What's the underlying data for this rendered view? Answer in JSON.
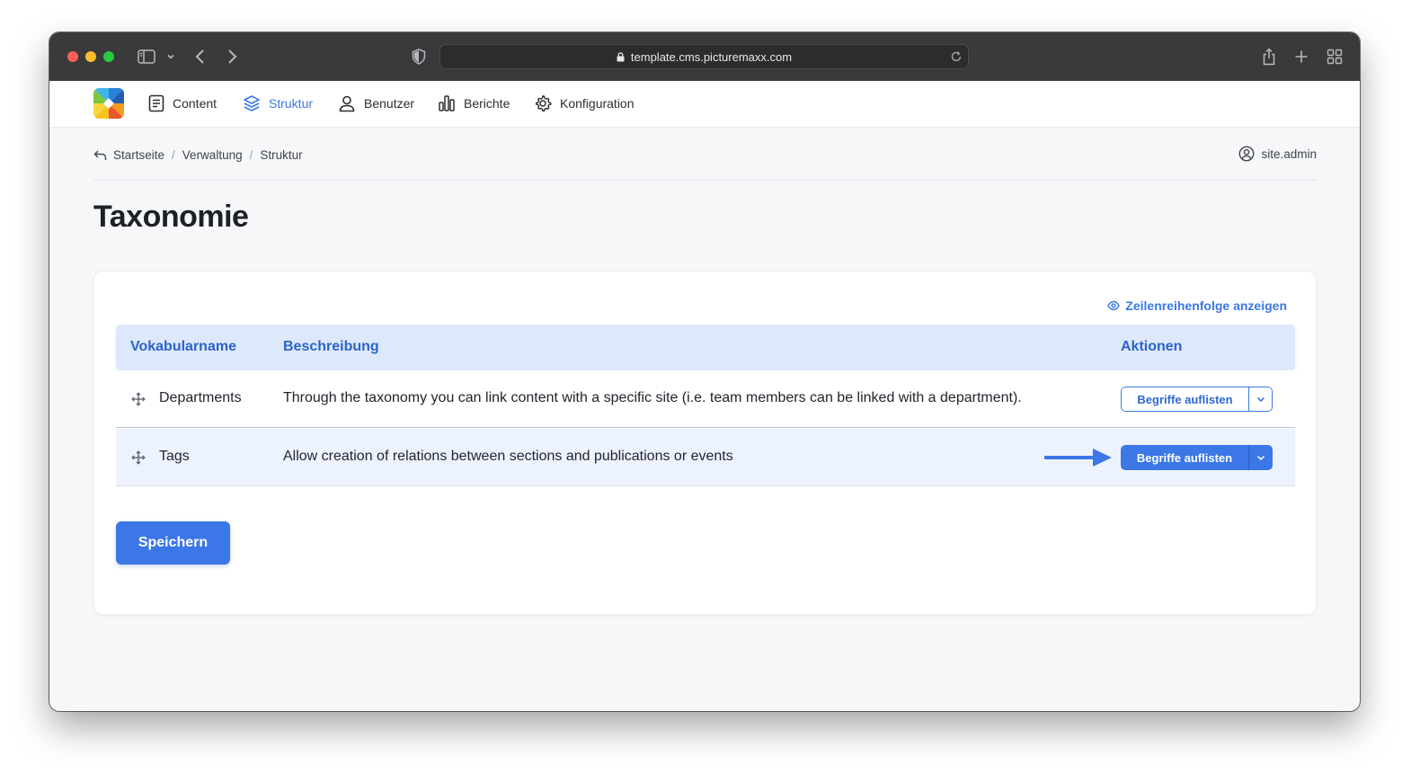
{
  "browser": {
    "url": "template.cms.picturemaxx.com"
  },
  "nav": {
    "items": [
      {
        "label": "Content",
        "icon": "document-icon"
      },
      {
        "label": "Struktur",
        "icon": "layers-icon",
        "active": true
      },
      {
        "label": "Benutzer",
        "icon": "user-icon"
      },
      {
        "label": "Berichte",
        "icon": "bar-chart-icon"
      },
      {
        "label": "Konfiguration",
        "icon": "gear-icon"
      }
    ]
  },
  "breadcrumb": [
    "Startseite",
    "Verwaltung",
    "Struktur"
  ],
  "user": {
    "name": "site.admin"
  },
  "page": {
    "title": "Taxonomie"
  },
  "table": {
    "row_order_link": "Zeilenreihenfolge anzeigen",
    "columns": [
      "Vokabularname",
      "Beschreibung",
      "Aktionen"
    ],
    "rows": [
      {
        "name": "Departments",
        "description": "Through the taxonomy you can link content with a specific site (i.e. team members can be linked with a department).",
        "action": "Begriffe auflisten"
      },
      {
        "name": "Tags",
        "description": "Allow creation of relations between sections and publications or events",
        "action": "Begriffe auflisten",
        "highlighted": true
      }
    ]
  },
  "save_label": "Speichern",
  "colors": {
    "accent": "#3b77e6",
    "header_bg": "#dde8fb",
    "highlight_row": "#edf3fe"
  }
}
